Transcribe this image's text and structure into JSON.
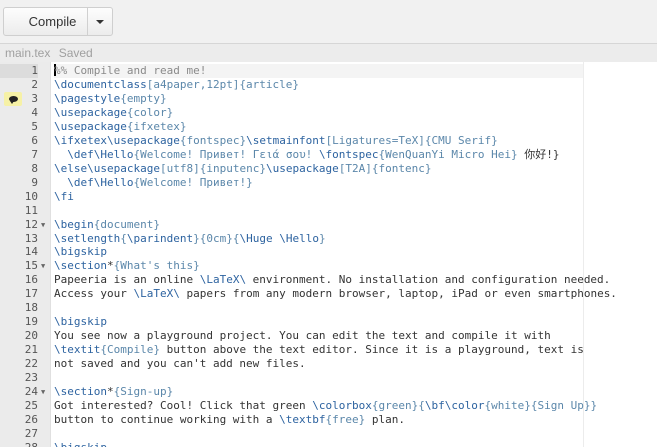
{
  "toolbar": {
    "compile_label": "Compile"
  },
  "tab": {
    "filename": "main.tex",
    "status": "Saved"
  },
  "colors": {
    "command": "#2d63a0",
    "argument": "#5b87aa",
    "text": "#333333",
    "comment": "#8a8a8a",
    "annotation": "#f6f1a6"
  },
  "editor": {
    "active_line": 1,
    "annotation_line": 3,
    "fold_lines": [
      12,
      15,
      24
    ],
    "lines": [
      [
        [
          "m",
          "%% Compile and read me!"
        ]
      ],
      [
        [
          "c",
          "\\documentclass"
        ],
        [
          "a",
          "[a4paper,12pt]{article}"
        ]
      ],
      [
        [
          "c",
          "\\pagestyle"
        ],
        [
          "a",
          "{empty}"
        ]
      ],
      [
        [
          "c",
          "\\usepackage"
        ],
        [
          "a",
          "{color}"
        ]
      ],
      [
        [
          "c",
          "\\usepackage"
        ],
        [
          "a",
          "{ifxetex}"
        ]
      ],
      [
        [
          "c",
          "\\ifxetex"
        ],
        [
          "c",
          "\\usepackage"
        ],
        [
          "a",
          "{fontspec}"
        ],
        [
          "c",
          "\\setmainfont"
        ],
        [
          "a",
          "[Ligatures=TeX]{CMU Serif}"
        ]
      ],
      [
        [
          "t",
          "  "
        ],
        [
          "c",
          "\\def"
        ],
        [
          "c",
          "\\Hello"
        ],
        [
          "a",
          "{Welcome! Привет! Γειά σου! "
        ],
        [
          "c",
          "\\fontspec"
        ],
        [
          "a",
          "{WenQuanYi Micro Hei}"
        ],
        [
          "t",
          " 你好!}"
        ]
      ],
      [
        [
          "c",
          "\\else"
        ],
        [
          "c",
          "\\usepackage"
        ],
        [
          "a",
          "[utf8]{inputenc}"
        ],
        [
          "c",
          "\\usepackage"
        ],
        [
          "a",
          "[T2A]{fontenc}"
        ]
      ],
      [
        [
          "t",
          "  "
        ],
        [
          "c",
          "\\def"
        ],
        [
          "c",
          "\\Hello"
        ],
        [
          "a",
          "{Welcome! Привет!}"
        ]
      ],
      [
        [
          "c",
          "\\fi"
        ]
      ],
      [],
      [
        [
          "c",
          "\\begin"
        ],
        [
          "a",
          "{document}"
        ]
      ],
      [
        [
          "c",
          "\\setlength"
        ],
        [
          "a",
          "{"
        ],
        [
          "c",
          "\\parindent"
        ],
        [
          "a",
          "}{0cm}{"
        ],
        [
          "c",
          "\\Huge"
        ],
        [
          "t",
          " "
        ],
        [
          "c",
          "\\Hello"
        ],
        [
          "a",
          "}"
        ]
      ],
      [
        [
          "c",
          "\\bigskip"
        ]
      ],
      [
        [
          "c",
          "\\section"
        ],
        [
          "t",
          "*"
        ],
        [
          "a",
          "{What's this}"
        ]
      ],
      [
        [
          "t",
          "Papeeria is an online "
        ],
        [
          "c",
          "\\LaTeX\\"
        ],
        [
          "t",
          " environment. No installation and configuration needed."
        ]
      ],
      [
        [
          "t",
          "Access your "
        ],
        [
          "c",
          "\\LaTeX\\"
        ],
        [
          "t",
          " papers from any modern browser, laptop, iPad or even smartphones."
        ]
      ],
      [],
      [
        [
          "c",
          "\\bigskip"
        ]
      ],
      [
        [
          "t",
          "You see now a playground project. You can edit the text and compile it with"
        ]
      ],
      [
        [
          "c",
          "\\textit"
        ],
        [
          "a",
          "{Compile}"
        ],
        [
          "t",
          " button above the text editor. Since it is a playground, text is"
        ]
      ],
      [
        [
          "t",
          "not saved and you can't add new files."
        ]
      ],
      [],
      [
        [
          "c",
          "\\section"
        ],
        [
          "t",
          "*"
        ],
        [
          "a",
          "{Sign-up}"
        ]
      ],
      [
        [
          "t",
          "Got interested? Cool! Click that green "
        ],
        [
          "c",
          "\\colorbox"
        ],
        [
          "a",
          "{green}{"
        ],
        [
          "c",
          "\\bf"
        ],
        [
          "c",
          "\\color"
        ],
        [
          "a",
          "{white}{Sign Up}}"
        ]
      ],
      [
        [
          "t",
          "button to continue working with a "
        ],
        [
          "c",
          "\\textbf"
        ],
        [
          "a",
          "{free}"
        ],
        [
          "t",
          " plan."
        ]
      ],
      [],
      [
        [
          "c",
          "\\bigskip"
        ]
      ]
    ]
  }
}
